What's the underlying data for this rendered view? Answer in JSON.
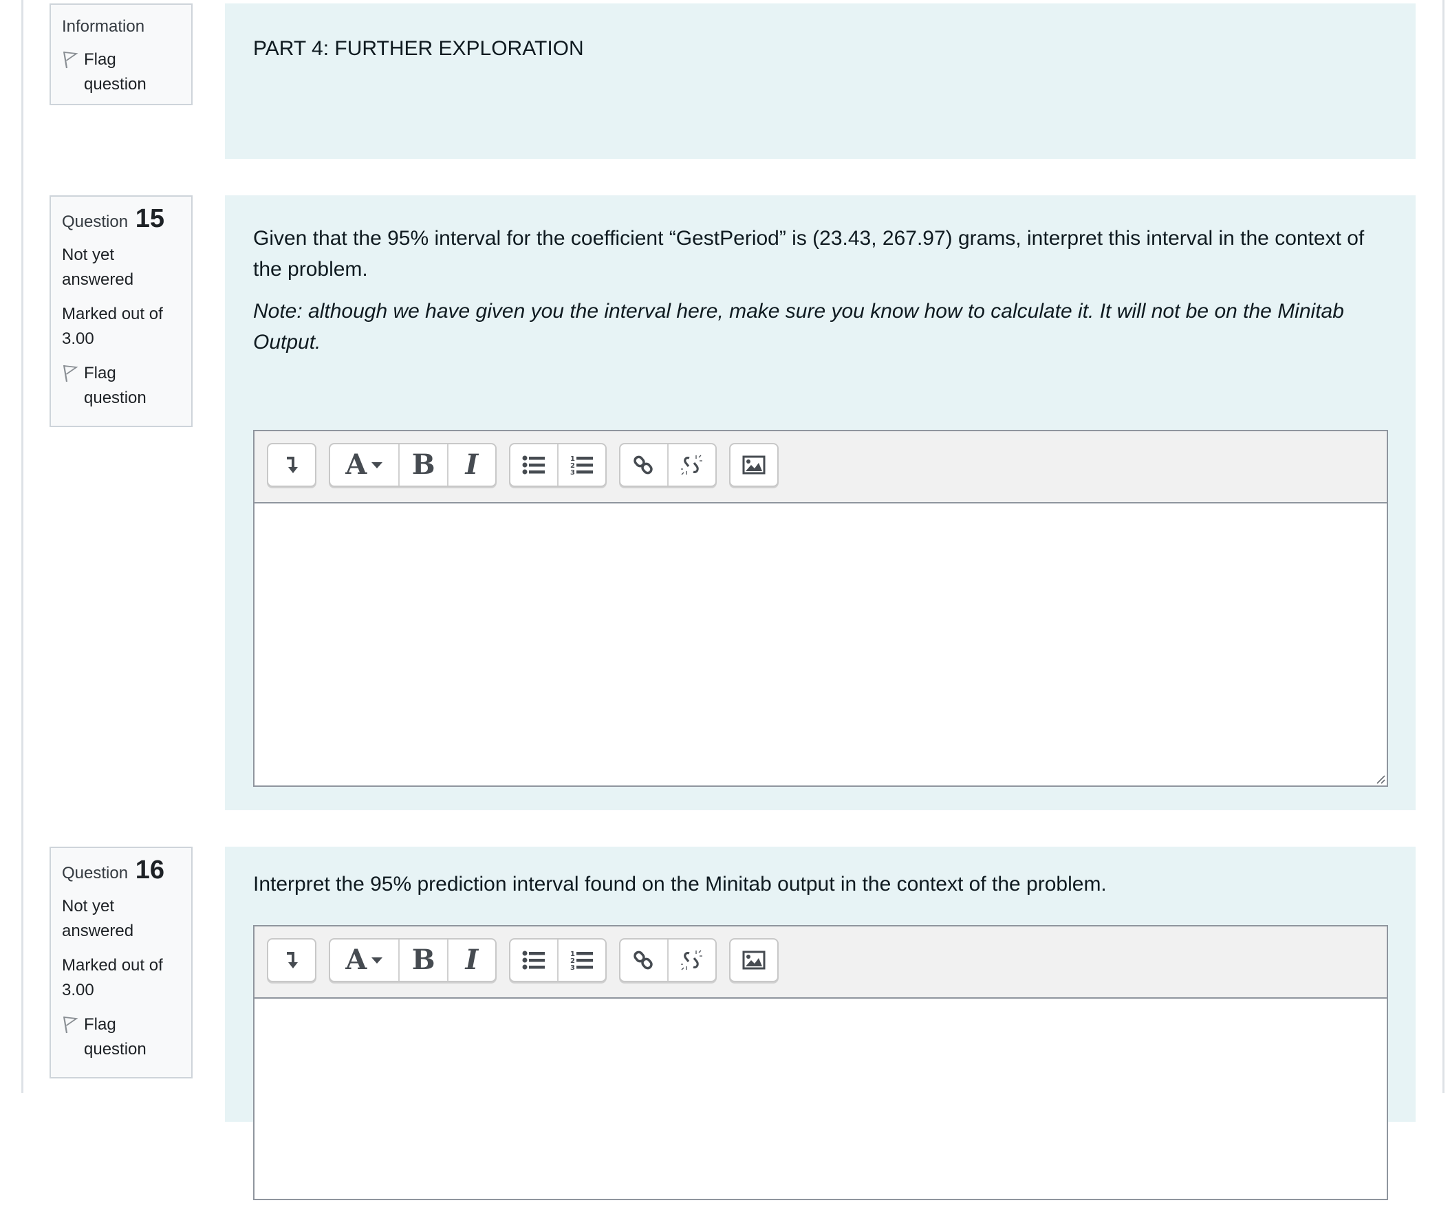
{
  "info_block": {
    "label": "Information",
    "flag_label": "Flag question",
    "text": "PART 4: FURTHER EXPLORATION"
  },
  "questions": [
    {
      "label": "Question",
      "number": "15",
      "status": "Not yet answered",
      "marks": "Marked out of 3.00",
      "flag_label": "Flag question",
      "text": "Given that the 95% interval for the coefficient “GestPeriod” is (23.43, 267.97) grams, interpret this interval in the context of the problem.",
      "note": "Note: although we have given you the interval here, make sure you know how to calculate it. It will not be on the Minitab Output.",
      "answer_value": ""
    },
    {
      "label": "Question",
      "number": "16",
      "status": "Not yet answered",
      "marks": "Marked out of 3.00",
      "flag_label": "Flag question",
      "text": "Interpret the 95% prediction interval found on the Minitab output in the context of the problem.",
      "answer_value": ""
    }
  ],
  "toolbar": {
    "buttons": [
      {
        "name": "toggle-toolbar",
        "icon": "level-down-arrow-icon"
      },
      {
        "name": "paragraph-styles",
        "icon": "font-style-dropdown-icon",
        "glyph": "A"
      },
      {
        "name": "bold",
        "icon": "bold-icon",
        "glyph": "B"
      },
      {
        "name": "italic",
        "icon": "italic-icon",
        "glyph": "I"
      },
      {
        "name": "unordered-list",
        "icon": "bullet-list-icon"
      },
      {
        "name": "ordered-list",
        "icon": "numbered-list-icon"
      },
      {
        "name": "link",
        "icon": "link-icon"
      },
      {
        "name": "unlink",
        "icon": "unlink-icon"
      },
      {
        "name": "image",
        "icon": "image-icon"
      }
    ]
  },
  "colors": {
    "panel_bg": "#e7f3f5",
    "info_bg": "#f8f9fa",
    "toolbar_bg": "#f1f1f1",
    "icon": "#464b51"
  }
}
